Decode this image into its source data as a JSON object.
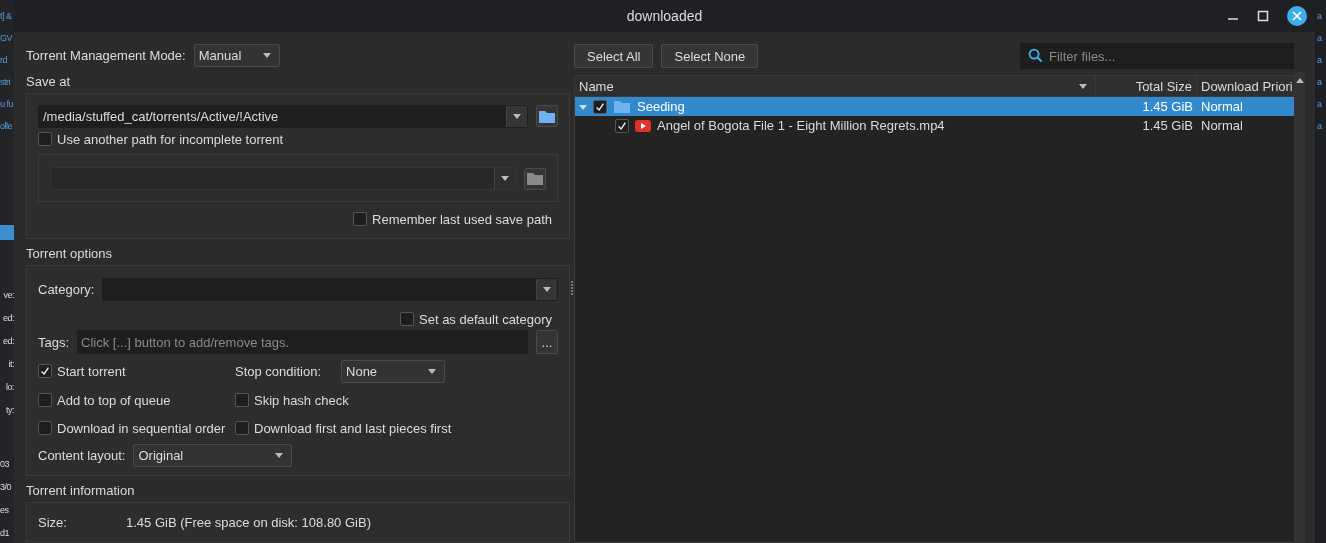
{
  "background_window": {
    "top_fragments": [
      "t] &",
      "GV",
      "rd",
      "stri",
      "u fu",
      "olle"
    ],
    "labels": [
      "ve:",
      "ed:",
      "ed:",
      "it:",
      "lo:",
      "ty:"
    ],
    "values": [
      "03",
      "3/0",
      "es",
      "d1"
    ],
    "right_fragments": [
      "a",
      "a",
      "a",
      "a",
      "a",
      "a"
    ]
  },
  "window": {
    "title": "downloaded"
  },
  "options": {
    "management_mode": {
      "label": "Torrent Management Mode:",
      "value": "Manual"
    },
    "save_at": {
      "title": "Save at",
      "path": "/media/stuffed_cat/torrents/Active/!Active",
      "use_another_path": {
        "label": "Use another path for incomplete torrent",
        "checked": false
      },
      "incomplete_path": {
        "disabled": true
      },
      "remember_path": {
        "label": "Remember last used save path",
        "checked": false
      }
    },
    "torrent_options": {
      "title": "Torrent options",
      "category_label": "Category:",
      "default_category": {
        "label": "Set as default category",
        "checked": false
      },
      "tags_label": "Tags:",
      "tags_placeholder": "Click [...] button to add/remove tags.",
      "tags_button": "...",
      "start_torrent": {
        "label": "Start torrent",
        "checked": true
      },
      "stop_condition": {
        "label": "Stop condition:",
        "value": "None"
      },
      "add_to_top": {
        "label": "Add to top of queue",
        "checked": false
      },
      "skip_hash": {
        "label": "Skip hash check",
        "checked": false
      },
      "sequential": {
        "label": "Download in sequential order",
        "checked": false
      },
      "first_last": {
        "label": "Download first and last pieces first",
        "checked": false
      },
      "content_layout": {
        "label": "Content layout:",
        "value": "Original"
      }
    },
    "torrent_information": {
      "title": "Torrent information",
      "size_label": "Size:",
      "size_value": "1.45 GiB (Free space on disk: 108.80 GiB)"
    }
  },
  "files": {
    "buttons": [
      "Select All",
      "Select None"
    ],
    "filter_placeholder": "Filter files...",
    "columns": [
      "Name",
      "Total Size",
      "Download Priori"
    ],
    "rows": [
      {
        "kind": "folder",
        "name": "Seeding",
        "size": "1.45 GiB",
        "priority": "Normal",
        "checked": true,
        "expanded": true,
        "selected": true,
        "children": [
          {
            "kind": "video",
            "name": "Angel of Bogota File 1 - Eight Million Regrets.mp4",
            "size": "1.45 GiB",
            "priority": "Normal",
            "checked": true,
            "selected": false
          }
        ]
      }
    ]
  }
}
